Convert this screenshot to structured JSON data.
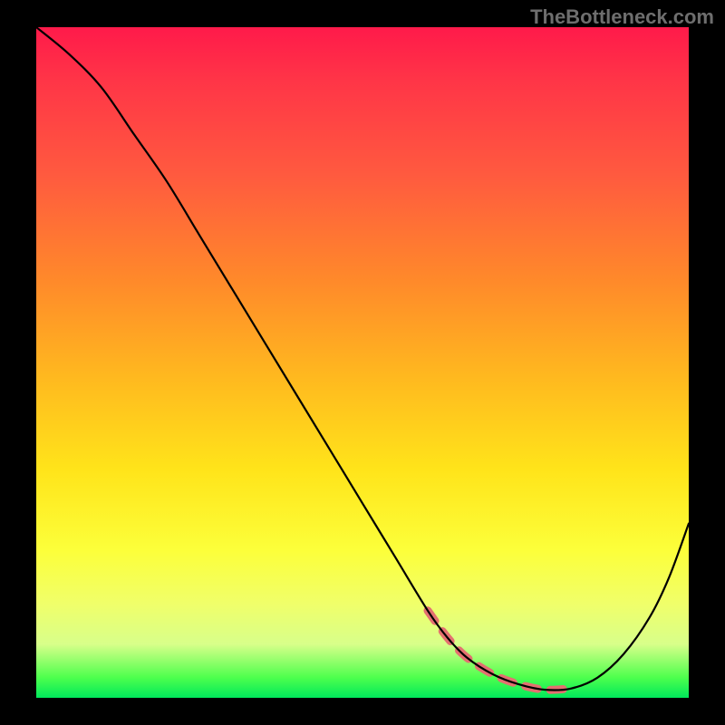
{
  "watermark": "TheBottleneck.com",
  "chart_data": {
    "type": "line",
    "title": "",
    "xlabel": "",
    "ylabel": "",
    "xlim": [
      0,
      100
    ],
    "ylim": [
      0,
      100
    ],
    "grid": false,
    "legend": false,
    "series": [
      {
        "name": "bottleneck-curve",
        "x": [
          0,
          5,
          10,
          15,
          20,
          25,
          30,
          35,
          40,
          45,
          50,
          55,
          60,
          63,
          66,
          70,
          74,
          78,
          82,
          86,
          90,
          94,
          97,
          100
        ],
        "y": [
          100,
          96,
          91,
          84,
          77,
          69,
          61,
          53,
          45,
          37,
          29,
          21,
          13,
          9,
          6,
          3.5,
          2,
          1.2,
          1.4,
          3,
          6.5,
          12,
          18,
          26
        ]
      }
    ],
    "accent_range_x": [
      60,
      84
    ],
    "background_gradient": {
      "top": "#ff1a4a",
      "mid1": "#ff8a2a",
      "mid2": "#ffe41a",
      "bottom": "#00e85b"
    }
  }
}
